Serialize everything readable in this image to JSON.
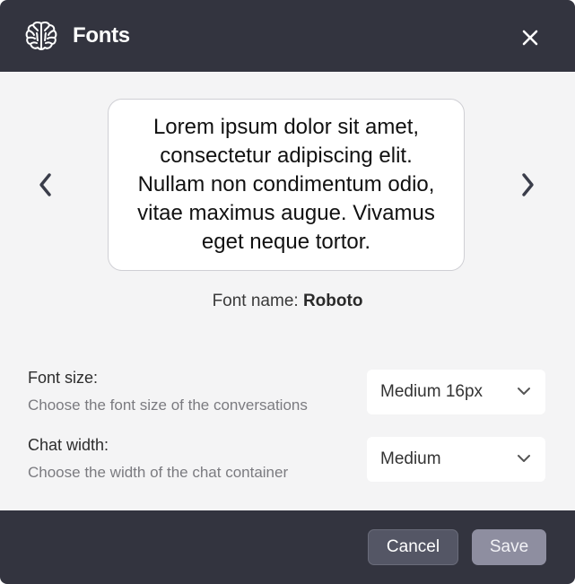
{
  "header": {
    "title": "Fonts",
    "icon": "brain-icon",
    "close_icon": "close-icon"
  },
  "preview": {
    "text": "Lorem ipsum dolor sit amet, consectetur adipiscing elit. Nullam non condimentum odio, vitae maximus augue. Vivamus eget neque tortor.",
    "prev_icon": "chevron-left-icon",
    "next_icon": "chevron-right-icon",
    "font_name_label": "Font name:",
    "font_name_value": "Roboto"
  },
  "settings": {
    "font_size": {
      "label": "Font size:",
      "description": "Choose the font size of the conversations",
      "selected": "Medium 16px"
    },
    "chat_width": {
      "label": "Chat width:",
      "description": "Choose the width of the chat container",
      "selected": "Medium"
    }
  },
  "footer": {
    "cancel_label": "Cancel",
    "save_label": "Save"
  },
  "colors": {
    "header_bg": "#33343f",
    "body_bg": "#f4f4f5",
    "cancel_bg": "#545665",
    "save_bg": "#8e8ea0"
  }
}
